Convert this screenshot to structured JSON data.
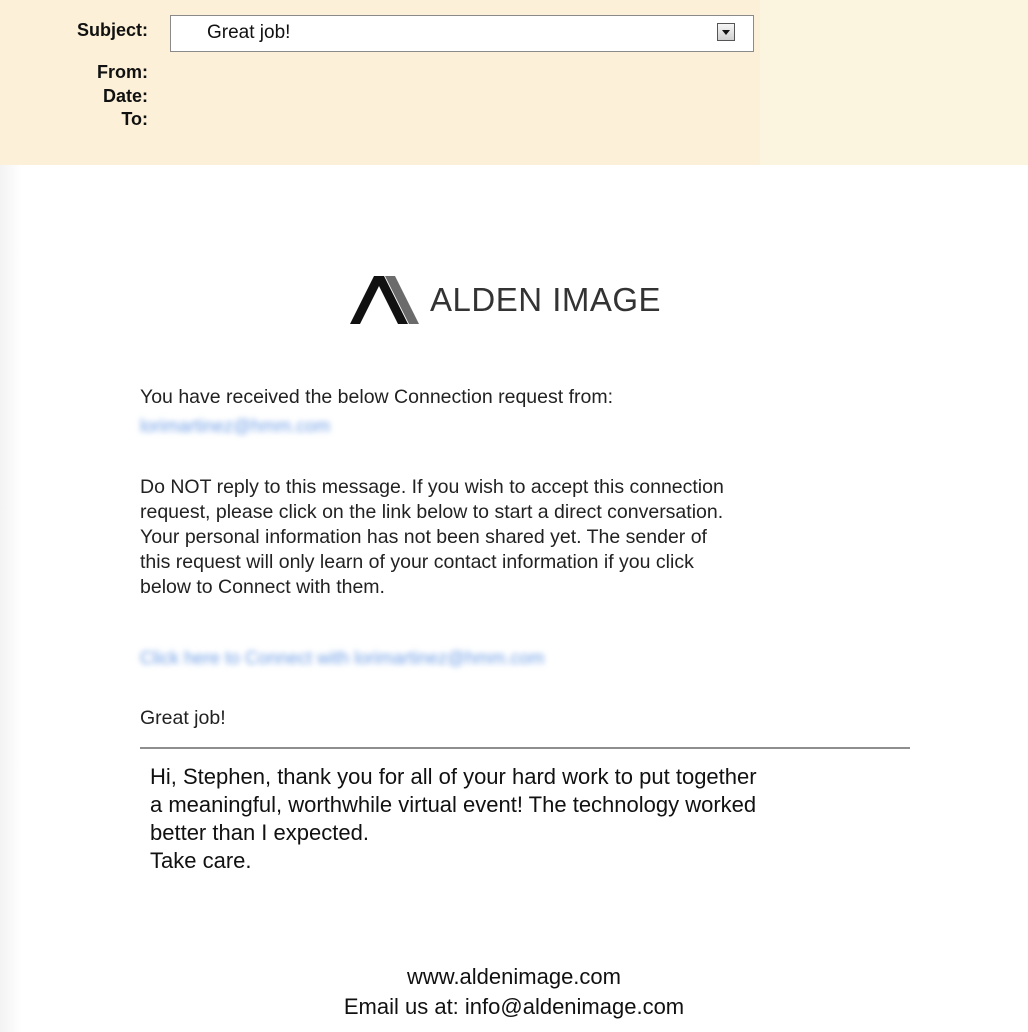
{
  "header": {
    "labels": {
      "subject": "Subject:",
      "from": "From:",
      "date": "Date:",
      "to": "To:"
    },
    "subject_value": "Great job!"
  },
  "logo": {
    "text": "ALDEN IMAGE",
    "icon": "alden-mark-icon"
  },
  "body": {
    "intro": "You have received the below Connection request from:",
    "notice_lines": [
      "Do NOT reply to this message. If you wish to accept this connection",
      "request, please click on the link below to start a direct conversation.",
      "Your personal information has not been shared yet. The sender of",
      "this request will only learn of your contact information if you click",
      "below to Connect with them."
    ],
    "greeting": "Great job!"
  },
  "message": {
    "lines": [
      "Hi, Stephen, thank you for all of your hard work to put together",
      "a meaningful, worthwhile virtual event! The technology worked",
      "better than I expected.",
      "Take care."
    ]
  },
  "footer": {
    "website": "www.aldenimage.com",
    "email": "Email us at: info@aldenimage.com"
  },
  "colors": {
    "header_bg": "#fcf1d8",
    "link_blue": "#6f9ee6"
  }
}
